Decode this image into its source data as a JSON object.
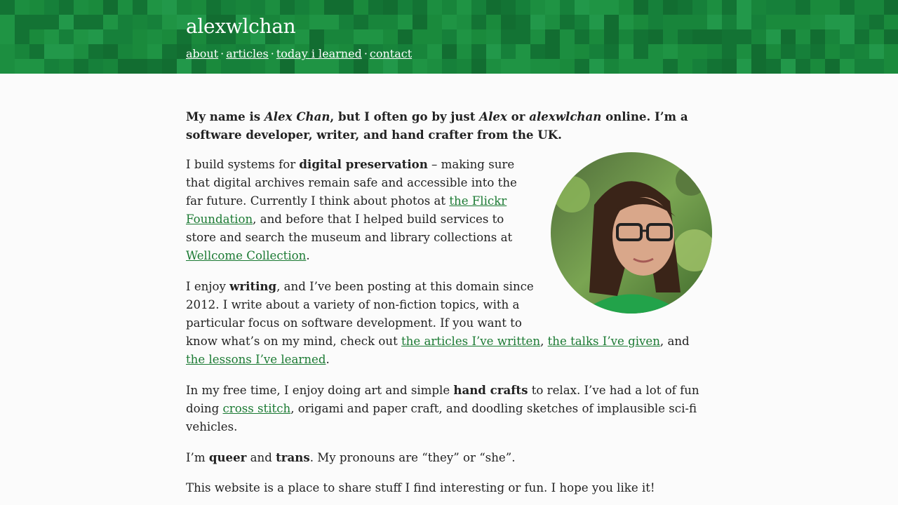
{
  "site": {
    "title": "alexwlchan",
    "nav": [
      {
        "label": "about"
      },
      {
        "label": "articles"
      },
      {
        "label": "today i learned"
      },
      {
        "label": "contact"
      }
    ],
    "nav_separator": "·"
  },
  "colors": {
    "header_green": "#1b8c3e",
    "link_green": "#1b7a33",
    "text": "#222222",
    "background": "#fbfbfb"
  },
  "intro": {
    "t1": "My name is ",
    "name": "Alex Chan",
    "t2": ", but I often go by just ",
    "alex": "Alex",
    "t3": " or ",
    "handle": "alexwlchan",
    "t4": " online. I’m a software developer, writer, and hand crafter from the UK."
  },
  "photo": {
    "description_icon": "profile-photo"
  },
  "p1": {
    "t1": "I build systems for ",
    "b1": "digital preservation",
    "t2": " – making sure that digital archives remain safe and accessible into the far future. Currently I think about photos at ",
    "link1": "the Flickr Foundation",
    "t3": ", and before that I helped build services to store and search the museum and library collections at ",
    "link2": "Wellcome Collection",
    "t4": "."
  },
  "p2": {
    "t1": "I enjoy ",
    "b1": "writing",
    "t2": ", and I’ve been posting at this domain since 2012. I write about a variety of non-fiction topics, with a particular focus on software development. If you want to know what’s on my mind, check out ",
    "link1": "the articles I’ve written",
    "t3": ", ",
    "link2": "the talks I’ve given",
    "t4": ", and ",
    "link3": "the lessons I’ve learned",
    "t5": "."
  },
  "p3": {
    "t1": "In my free time, I enjoy doing art and simple ",
    "b1": "hand crafts",
    "t2": " to relax. I’ve had a lot of fun doing ",
    "link1": "cross stitch",
    "t3": ", origami and paper craft, and doodling sketches of implausible sci-fi vehicles."
  },
  "p4": {
    "t1": "I’m ",
    "b1": "queer",
    "t2": " and ",
    "b2": "trans",
    "t3": ". My pronouns are “they” or “she”."
  },
  "p5": {
    "t1": "This website is a place to share stuff I find interesting or fun. I hope you like it!"
  }
}
